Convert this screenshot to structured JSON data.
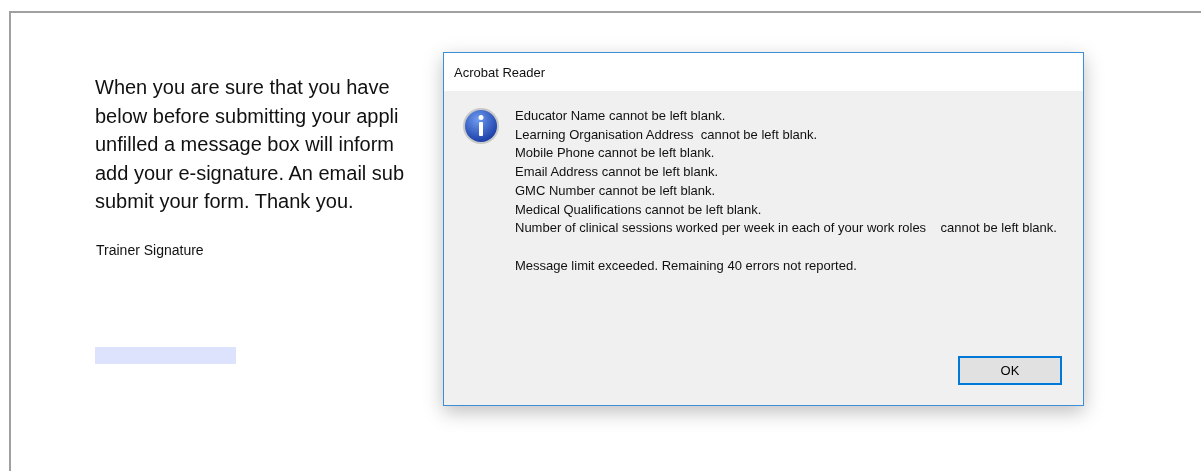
{
  "document": {
    "paragraph_lines": [
      "When you are sure that you have",
      "below before submitting your appli",
      "unfilled a message box will inform",
      "add your e-signature. An email sub",
      "submit your form. Thank you."
    ],
    "signature_label": "Trainer Signature"
  },
  "dialog": {
    "title": "Acrobat Reader",
    "messages": [
      "Educator Name cannot be left blank.",
      "Learning Organisation Address  cannot be left blank.",
      "Mobile Phone cannot be left blank.",
      "Email Address cannot be left blank.",
      "GMC Number cannot be left blank.",
      "Medical Qualifications cannot be left blank.",
      "Number of clinical sessions worked per week in each of your work roles    cannot be left blank."
    ],
    "note": "Message limit exceeded. Remaining 40 errors not reported.",
    "buttons": [
      {
        "label": "OK",
        "default": true
      }
    ]
  }
}
